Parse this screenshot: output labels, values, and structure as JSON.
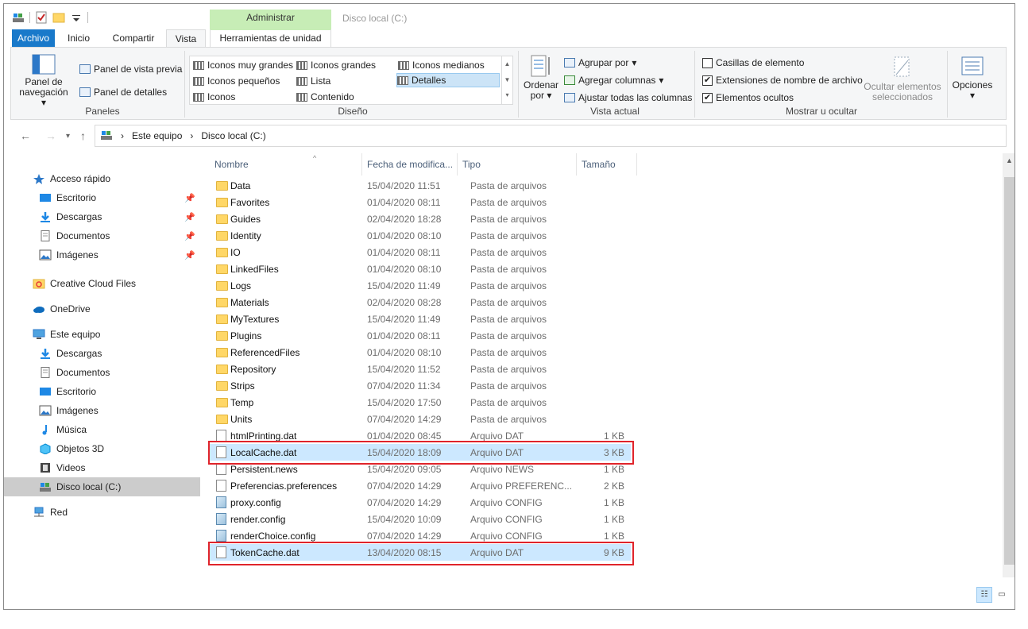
{
  "window": {
    "title": "Disco local (C:)",
    "context_tab": "Administrar"
  },
  "ribbon_tabs": [
    "Archivo",
    "Inicio",
    "Compartir",
    "Vista",
    "Herramientas de unidad"
  ],
  "ribbon": {
    "paneles": {
      "label": "Paneles",
      "nav_pane_line1": "Panel de",
      "nav_pane_line2": "navegación",
      "preview_pane": "Panel de vista previa",
      "details_pane": "Panel de detalles"
    },
    "diseno": {
      "label": "Diseño",
      "items": [
        "Iconos muy grandes",
        "Iconos grandes",
        "Iconos medianos",
        "Iconos pequeños",
        "Lista",
        "Detalles",
        "Iconos",
        "Contenido"
      ],
      "selected": "Detalles"
    },
    "vista_actual": {
      "label": "Vista actual",
      "sort_line1": "Ordenar",
      "sort_line2": "por",
      "group_by": "Agrupar por",
      "add_columns": "Agregar columnas",
      "fit_columns": "Ajustar todas las columnas"
    },
    "mostrar": {
      "label": "Mostrar u ocultar",
      "checkboxes": [
        {
          "label": "Casillas de elemento",
          "checked": false
        },
        {
          "label": "Extensiones de nombre de archivo",
          "checked": true
        },
        {
          "label": "Elementos ocultos",
          "checked": true
        }
      ],
      "hide_selected_line1": "Ocultar elementos",
      "hide_selected_line2": "seleccionados"
    },
    "opciones": {
      "label": "Opciones"
    }
  },
  "address": {
    "segments": [
      "Este equipo",
      "Disco local (C:)"
    ]
  },
  "sidebar": {
    "items": [
      {
        "label": "Acceso rápido",
        "icon": "star-icon",
        "pinned": false
      },
      {
        "label": "Escritorio",
        "icon": "desktop-icon",
        "pinned": true
      },
      {
        "label": "Descargas",
        "icon": "download-icon",
        "pinned": true
      },
      {
        "label": "Documentos",
        "icon": "document-icon",
        "pinned": true
      },
      {
        "label": "Imágenes",
        "icon": "pictures-icon",
        "pinned": true
      },
      {
        "label": "Creative Cloud Files",
        "icon": "creative-cloud-icon",
        "pinned": false
      },
      {
        "label": "OneDrive",
        "icon": "cloud-icon",
        "pinned": false
      },
      {
        "label": "Este equipo",
        "icon": "computer-icon",
        "pinned": false
      },
      {
        "label": "Descargas",
        "icon": "download-icon",
        "pinned": false
      },
      {
        "label": "Documentos",
        "icon": "document-icon",
        "pinned": false
      },
      {
        "label": "Escritorio",
        "icon": "desktop-icon",
        "pinned": false
      },
      {
        "label": "Imágenes",
        "icon": "pictures-icon",
        "pinned": false
      },
      {
        "label": "Música",
        "icon": "music-icon",
        "pinned": false
      },
      {
        "label": "Objetos 3D",
        "icon": "cube-icon",
        "pinned": false
      },
      {
        "label": "Videos",
        "icon": "video-icon",
        "pinned": false
      },
      {
        "label": "Disco local (C:)",
        "icon": "drive-icon",
        "pinned": false,
        "selected": true
      },
      {
        "label": "Red",
        "icon": "network-icon",
        "pinned": false
      }
    ]
  },
  "columns": [
    "Nombre",
    "Fecha de modifica...",
    "Tipo",
    "Tamaño"
  ],
  "files": [
    {
      "name": "Data",
      "date": "15/04/2020 11:51",
      "type": "Pasta de arquivos",
      "size": "",
      "kind": "folder"
    },
    {
      "name": "Favorites",
      "date": "01/04/2020 08:11",
      "type": "Pasta de arquivos",
      "size": "",
      "kind": "folder"
    },
    {
      "name": "Guides",
      "date": "02/04/2020 18:28",
      "type": "Pasta de arquivos",
      "size": "",
      "kind": "folder"
    },
    {
      "name": "Identity",
      "date": "01/04/2020 08:10",
      "type": "Pasta de arquivos",
      "size": "",
      "kind": "folder"
    },
    {
      "name": "IO",
      "date": "01/04/2020 08:11",
      "type": "Pasta de arquivos",
      "size": "",
      "kind": "folder"
    },
    {
      "name": "LinkedFiles",
      "date": "01/04/2020 08:10",
      "type": "Pasta de arquivos",
      "size": "",
      "kind": "folder"
    },
    {
      "name": "Logs",
      "date": "15/04/2020 11:49",
      "type": "Pasta de arquivos",
      "size": "",
      "kind": "folder"
    },
    {
      "name": "Materials",
      "date": "02/04/2020 08:28",
      "type": "Pasta de arquivos",
      "size": "",
      "kind": "folder"
    },
    {
      "name": "MyTextures",
      "date": "15/04/2020 11:49",
      "type": "Pasta de arquivos",
      "size": "",
      "kind": "folder"
    },
    {
      "name": "Plugins",
      "date": "01/04/2020 08:11",
      "type": "Pasta de arquivos",
      "size": "",
      "kind": "folder"
    },
    {
      "name": "ReferencedFiles",
      "date": "01/04/2020 08:10",
      "type": "Pasta de arquivos",
      "size": "",
      "kind": "folder"
    },
    {
      "name": "Repository",
      "date": "15/04/2020 11:52",
      "type": "Pasta de arquivos",
      "size": "",
      "kind": "folder"
    },
    {
      "name": "Strips",
      "date": "07/04/2020 11:34",
      "type": "Pasta de arquivos",
      "size": "",
      "kind": "folder"
    },
    {
      "name": "Temp",
      "date": "15/04/2020 17:50",
      "type": "Pasta de arquivos",
      "size": "",
      "kind": "folder"
    },
    {
      "name": "Units",
      "date": "07/04/2020 14:29",
      "type": "Pasta de arquivos",
      "size": "",
      "kind": "folder"
    },
    {
      "name": "htmlPrinting.dat",
      "date": "01/04/2020 08:45",
      "type": "Arquivo DAT",
      "size": "1 KB",
      "kind": "doc"
    },
    {
      "name": "LocalCache.dat",
      "date": "15/04/2020 18:09",
      "type": "Arquivo DAT",
      "size": "3 KB",
      "kind": "doc",
      "highlighted": true
    },
    {
      "name": "Persistent.news",
      "date": "15/04/2020 09:05",
      "type": "Arquivo NEWS",
      "size": "1 KB",
      "kind": "doc"
    },
    {
      "name": "Preferencias.preferences",
      "date": "07/04/2020 14:29",
      "type": "Arquivo PREFERENC...",
      "size": "2 KB",
      "kind": "doc"
    },
    {
      "name": "proxy.config",
      "date": "07/04/2020 14:29",
      "type": "Arquivo CONFIG",
      "size": "1 KB",
      "kind": "cfg"
    },
    {
      "name": "render.config",
      "date": "15/04/2020 10:09",
      "type": "Arquivo CONFIG",
      "size": "1 KB",
      "kind": "cfg"
    },
    {
      "name": "renderChoice.config",
      "date": "07/04/2020 14:29",
      "type": "Arquivo CONFIG",
      "size": "1 KB",
      "kind": "cfg"
    },
    {
      "name": "TokenCache.dat",
      "date": "13/04/2020 08:15",
      "type": "Arquivo DAT",
      "size": "9 KB",
      "kind": "doc",
      "highlighted": true
    }
  ],
  "colors": {
    "accent": "#1979ca",
    "highlight": "#cce8ff",
    "annotation": "#e0242b",
    "folder": "#ffd767"
  }
}
